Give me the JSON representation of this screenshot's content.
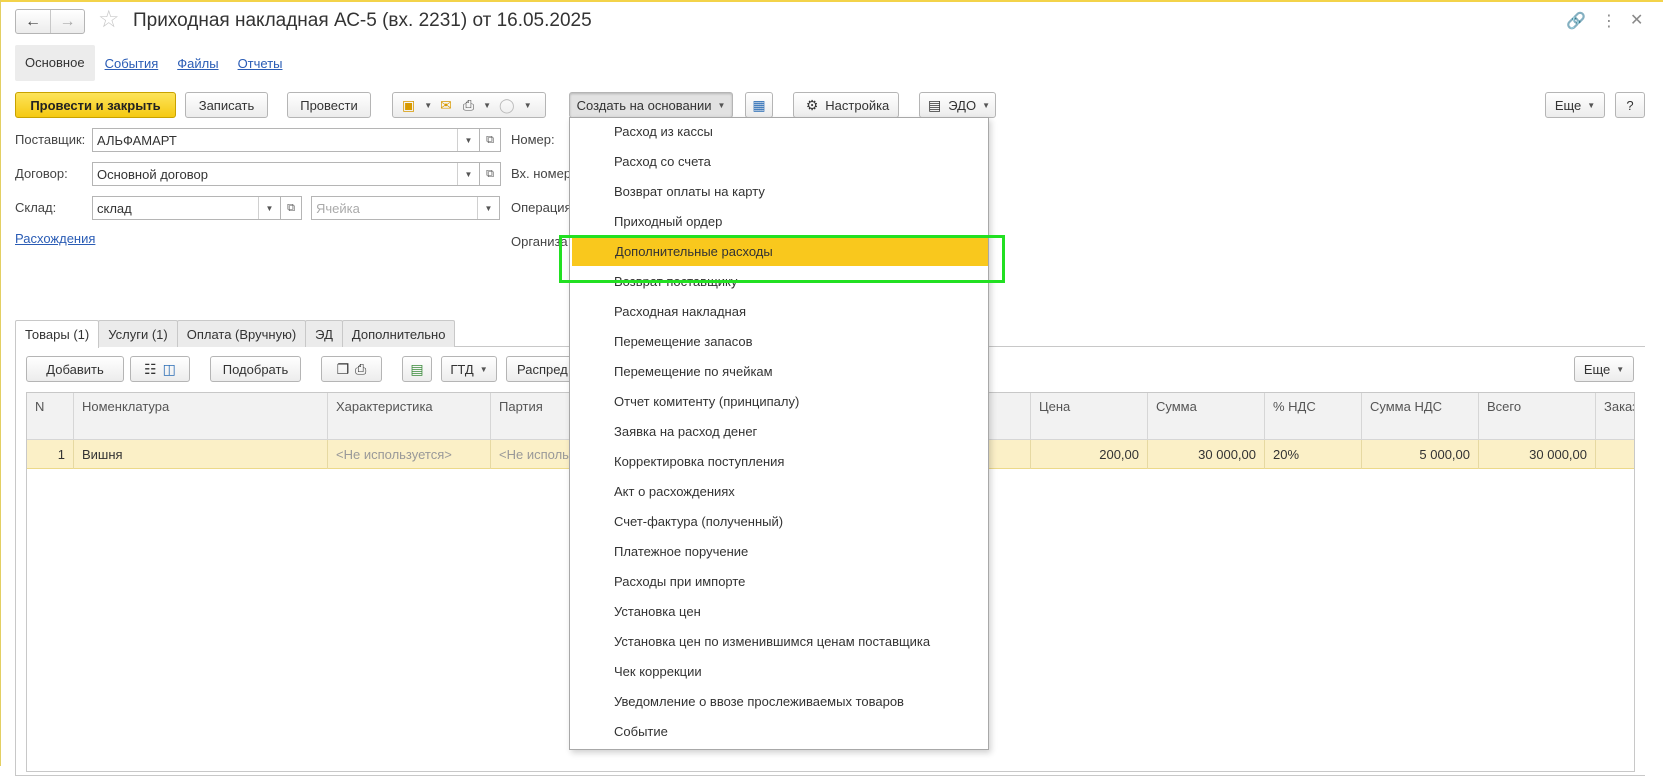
{
  "window": {
    "title": "Приходная накладная АС-5 (вх. 2231) от 16.05.2025"
  },
  "topnav": {
    "active": "Основное",
    "links": [
      "События",
      "Файлы",
      "Отчеты"
    ]
  },
  "toolbar": {
    "post_close": "Провести и закрыть",
    "save": "Записать",
    "post": "Провести",
    "create_based": "Создать на основании",
    "settings": "Настройка",
    "edo": "ЭДО",
    "more": "Еще",
    "help": "?"
  },
  "form": {
    "supplier_label": "Поставщик:",
    "supplier_value": "АЛЬФАМАРТ",
    "contract_label": "Договор:",
    "contract_value": "Основной договор",
    "warehouse_label": "Склад:",
    "warehouse_value": "склад",
    "cell_placeholder": "Ячейка",
    "discrepancies_link": "Расхождения",
    "number_label": "Номер:",
    "incoming_number_label": "Вх. номер",
    "operation_label": "Операция",
    "organization_label": "Организа"
  },
  "tabs": [
    "Товары (1)",
    "Услуги (1)",
    "Оплата (Вручную)",
    "ЭД",
    "Дополнительно"
  ],
  "table_toolbar": {
    "add": "Добавить",
    "pick": "Подобрать",
    "gtd": "ГТД",
    "distribute": "Распред",
    "more": "Еще"
  },
  "table": {
    "columns": [
      "N",
      "Номенклатура",
      "Характеристика",
      "Партия",
      "Цена",
      "Сумма",
      "% НДС",
      "Сумма НДС",
      "Всего",
      "Заказ пос"
    ],
    "rows": [
      {
        "n": "1",
        "item": "Вишня",
        "characteristic": "<Не используется>",
        "batch": "<Не исполь",
        "price": "200,00",
        "sum": "30 000,00",
        "vat_rate": "20%",
        "vat_sum": "5 000,00",
        "total": "30 000,00"
      }
    ]
  },
  "dropdown": {
    "items": [
      "Расход из кассы",
      "Расход со счета",
      "Возврат оплаты на карту",
      "Приходный ордер",
      "Дополнительные расходы",
      "Возврат поставщику",
      "Расходная накладная",
      "Перемещение запасов",
      "Перемещение по ячейкам",
      "Отчет комитенту (принципалу)",
      "Заявка на расход денег",
      "Корректировка поступления",
      "Акт о расхождениях",
      "Счет-фактура (полученный)",
      "Платежное поручение",
      "Расходы при импорте",
      "Установка цен",
      "Установка цен по изменившимся ценам поставщика",
      "Чек коррекции",
      "Уведомление о ввозе прослеживаемых товаров",
      "Событие"
    ],
    "highlighted": "Дополнительные расходы"
  },
  "colors": {
    "primary_button": "#f5c912",
    "highlight_row": "#fbf0c7",
    "menu_highlight": "#f9c81d",
    "annotation_frame": "#22e022",
    "link": "#2a5cb5"
  },
  "icons": [
    "back-arrow-icon",
    "forward-arrow-icon",
    "star-icon",
    "link-icon",
    "more-vertical-icon",
    "close-icon",
    "document-icon",
    "mail-icon",
    "printer-icon",
    "circle-icon",
    "structure-icon",
    "gear-icon",
    "edo-icon",
    "barcode-icon",
    "scanner-icon",
    "copy-icon",
    "paste-icon",
    "table-icon"
  ]
}
